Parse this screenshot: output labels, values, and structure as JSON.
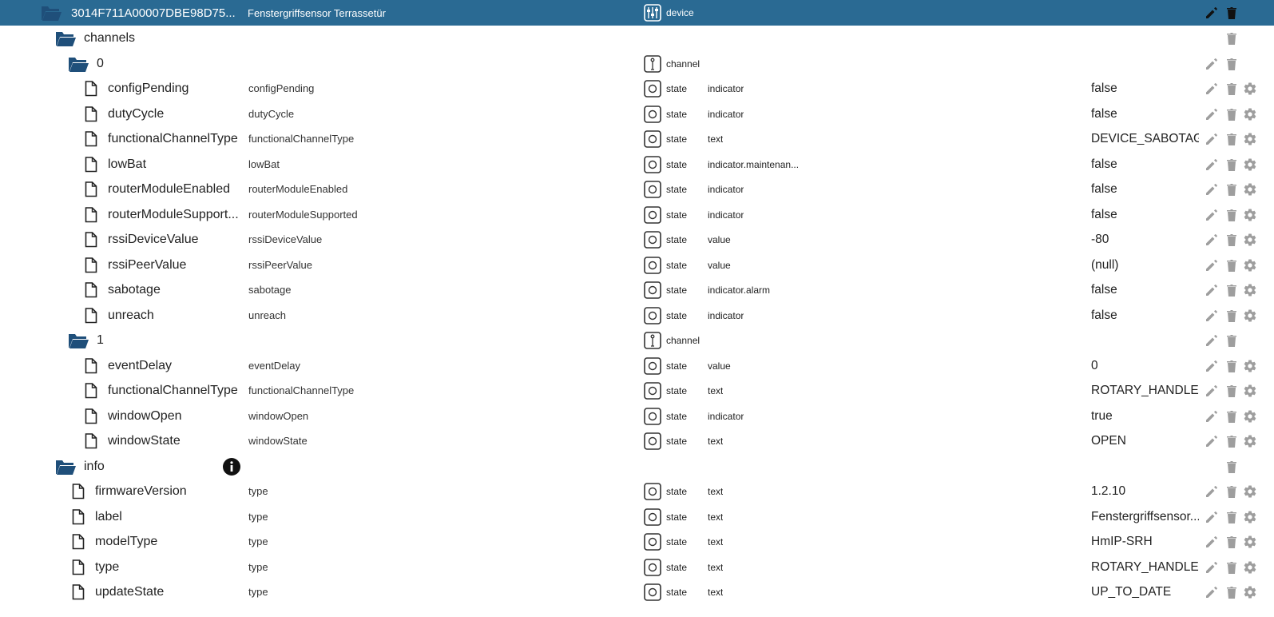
{
  "device": {
    "id_label": "3014F711A00007DBE98D75...",
    "name": "Fenstergriffsensor Terrassetür",
    "type": "device"
  },
  "rows": [
    {
      "level": "folder",
      "indent": 1,
      "label": "channels",
      "desc": "",
      "type": "",
      "role": "",
      "value": "",
      "actions": [
        "delete"
      ],
      "info": false
    },
    {
      "level": "folder",
      "indent": 2,
      "label": "0",
      "desc": "",
      "type": "channel",
      "role": "",
      "value": "",
      "actions": [
        "edit",
        "delete"
      ],
      "info": false
    },
    {
      "level": "state",
      "indent": 3,
      "label": "configPending",
      "desc": "configPending",
      "type": "state",
      "role": "indicator",
      "value": "false",
      "actions": [
        "edit",
        "delete",
        "settings"
      ],
      "info": false
    },
    {
      "level": "state",
      "indent": 3,
      "label": "dutyCycle",
      "desc": "dutyCycle",
      "type": "state",
      "role": "indicator",
      "value": "false",
      "actions": [
        "edit",
        "delete",
        "settings"
      ],
      "info": false
    },
    {
      "level": "state",
      "indent": 3,
      "label": "functionalChannelType",
      "desc": "functionalChannelType",
      "type": "state",
      "role": "text",
      "value": "DEVICE_SABOTAGE",
      "actions": [
        "edit",
        "delete",
        "settings"
      ],
      "info": false
    },
    {
      "level": "state",
      "indent": 3,
      "label": "lowBat",
      "desc": "lowBat",
      "type": "state",
      "role": "indicator.maintenan...",
      "value": "false",
      "actions": [
        "edit",
        "delete",
        "settings"
      ],
      "info": false
    },
    {
      "level": "state",
      "indent": 3,
      "label": "routerModuleEnabled",
      "desc": "routerModuleEnabled",
      "type": "state",
      "role": "indicator",
      "value": "false",
      "actions": [
        "edit",
        "delete",
        "settings"
      ],
      "info": false
    },
    {
      "level": "state",
      "indent": 3,
      "label": "routerModuleSupport...",
      "desc": "routerModuleSupported",
      "type": "state",
      "role": "indicator",
      "value": "false",
      "actions": [
        "edit",
        "delete",
        "settings"
      ],
      "info": false
    },
    {
      "level": "state",
      "indent": 3,
      "label": "rssiDeviceValue",
      "desc": "rssiDeviceValue",
      "type": "state",
      "role": "value",
      "value": "-80",
      "actions": [
        "edit",
        "delete",
        "settings"
      ],
      "info": false
    },
    {
      "level": "state",
      "indent": 3,
      "label": "rssiPeerValue",
      "desc": "rssiPeerValue",
      "type": "state",
      "role": "value",
      "value": "(null)",
      "actions": [
        "edit",
        "delete",
        "settings"
      ],
      "info": false
    },
    {
      "level": "state",
      "indent": 3,
      "label": "sabotage",
      "desc": "sabotage",
      "type": "state",
      "role": "indicator.alarm",
      "value": "false",
      "actions": [
        "edit",
        "delete",
        "settings"
      ],
      "info": false
    },
    {
      "level": "state",
      "indent": 3,
      "label": "unreach",
      "desc": "unreach",
      "type": "state",
      "role": "indicator",
      "value": "false",
      "actions": [
        "edit",
        "delete",
        "settings"
      ],
      "info": false
    },
    {
      "level": "folder",
      "indent": 2,
      "label": "1",
      "desc": "",
      "type": "channel",
      "role": "",
      "value": "",
      "actions": [
        "edit",
        "delete"
      ],
      "info": false
    },
    {
      "level": "state",
      "indent": 3,
      "label": "eventDelay",
      "desc": "eventDelay",
      "type": "state",
      "role": "value",
      "value": "0",
      "actions": [
        "edit",
        "delete",
        "settings"
      ],
      "info": false
    },
    {
      "level": "state",
      "indent": 3,
      "label": "functionalChannelType",
      "desc": "functionalChannelType",
      "type": "state",
      "role": "text",
      "value": "ROTARY_HANDLE...",
      "actions": [
        "edit",
        "delete",
        "settings"
      ],
      "info": false
    },
    {
      "level": "state",
      "indent": 3,
      "label": "windowOpen",
      "desc": "windowOpen",
      "type": "state",
      "role": "indicator",
      "value": "true",
      "actions": [
        "edit",
        "delete",
        "settings"
      ],
      "info": false
    },
    {
      "level": "state",
      "indent": 3,
      "label": "windowState",
      "desc": "windowState",
      "type": "state",
      "role": "text",
      "value": "OPEN",
      "actions": [
        "edit",
        "delete",
        "settings"
      ],
      "info": false
    },
    {
      "level": "folder",
      "indent": 1,
      "label": "info",
      "desc": "",
      "type": "",
      "role": "",
      "value": "",
      "actions": [
        "delete"
      ],
      "info": true
    },
    {
      "level": "state",
      "indent": 2,
      "label": "firmwareVersion",
      "desc": "type",
      "type": "state",
      "role": "text",
      "value": "1.2.10",
      "actions": [
        "edit",
        "delete",
        "settings"
      ],
      "info": false
    },
    {
      "level": "state",
      "indent": 2,
      "label": "label",
      "desc": "type",
      "type": "state",
      "role": "text",
      "value": "Fenstergriffsensor...",
      "actions": [
        "edit",
        "delete",
        "settings"
      ],
      "info": false
    },
    {
      "level": "state",
      "indent": 2,
      "label": "modelType",
      "desc": "type",
      "type": "state",
      "role": "text",
      "value": "HmIP-SRH",
      "actions": [
        "edit",
        "delete",
        "settings"
      ],
      "info": false
    },
    {
      "level": "state",
      "indent": 2,
      "label": "type",
      "desc": "type",
      "type": "state",
      "role": "text",
      "value": "ROTARY_HANDLE...",
      "actions": [
        "edit",
        "delete",
        "settings"
      ],
      "info": false
    },
    {
      "level": "state",
      "indent": 2,
      "label": "updateState",
      "desc": "type",
      "type": "state",
      "role": "text",
      "value": "UP_TO_DATE",
      "actions": [
        "edit",
        "delete",
        "settings"
      ],
      "info": false
    }
  ],
  "colors": {
    "header_bg": "#2a6a93",
    "folder": "#1f4f7a",
    "icon": "#333333",
    "action": "#9e9e9e",
    "action_header": "#111111"
  }
}
